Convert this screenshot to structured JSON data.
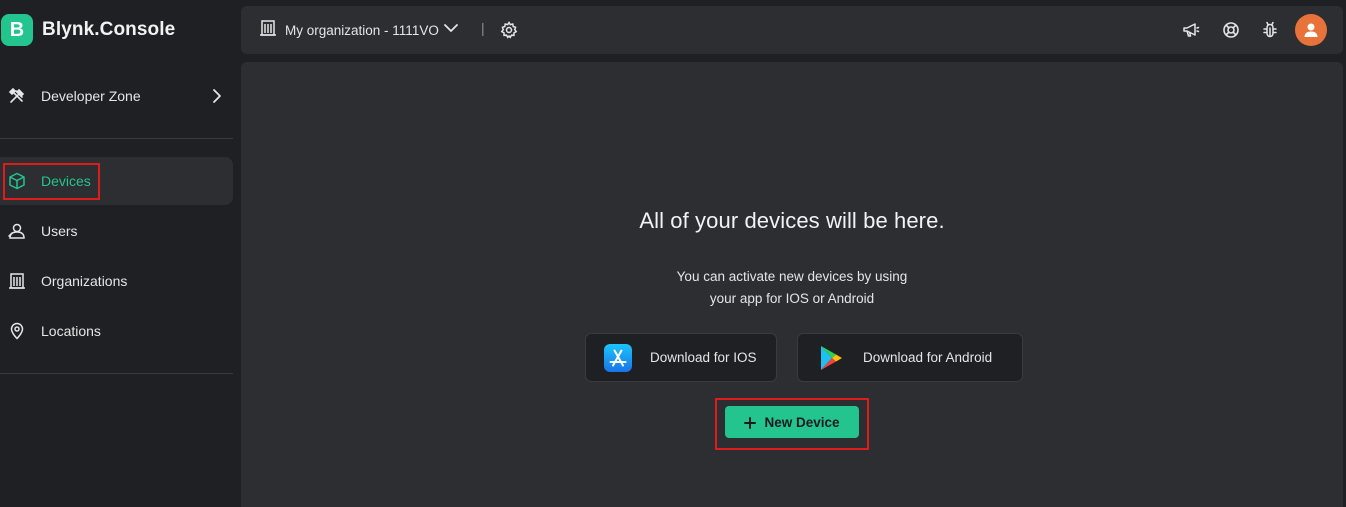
{
  "brand": {
    "logo_letter": "B",
    "name": "Blynk.Console"
  },
  "sidebar": {
    "developer_zone": {
      "label": "Developer Zone",
      "icon": "tools-icon"
    },
    "items": [
      {
        "label": "Devices",
        "icon": "cube-icon",
        "active": true
      },
      {
        "label": "Users",
        "icon": "users-icon"
      },
      {
        "label": "Organizations",
        "icon": "building-icon"
      },
      {
        "label": "Locations",
        "icon": "pin-icon"
      }
    ]
  },
  "topbar": {
    "org_label": "My organization - 1111VO",
    "separator": "|",
    "icons": [
      "megaphone-icon",
      "help-icon",
      "bug-icon"
    ]
  },
  "main": {
    "empty_title": "All of your devices will be here.",
    "empty_desc_line1": "You can activate new devices by using",
    "empty_desc_line2": "your app for IOS or Android",
    "ios_button": "Download for IOS",
    "android_button": "Download for Android",
    "new_device_button": "New Device"
  },
  "colors": {
    "accent": "#23c48e",
    "background": "#1f2023",
    "panel": "#2d2e32",
    "highlight": "#e01b1b",
    "avatar": "#e8733a"
  }
}
